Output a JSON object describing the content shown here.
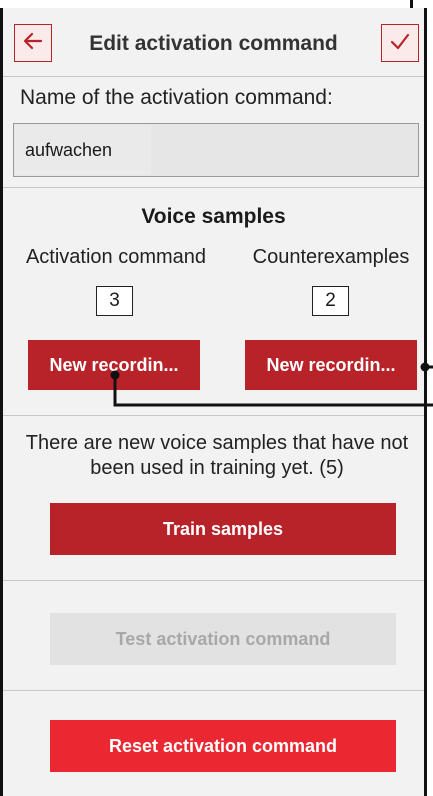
{
  "header": {
    "title": "Edit activation command",
    "back_icon": "arrow-left-icon",
    "confirm_icon": "checkmark-icon",
    "accent_color": "#b8232a"
  },
  "name_section": {
    "label": "Name of the activation command:",
    "value": "aufwachen"
  },
  "voice_samples": {
    "title": "Voice samples",
    "activation": {
      "label": "Activation command",
      "count": "3",
      "button": "New recordin..."
    },
    "counter": {
      "label": "Counterexamples",
      "count": "2",
      "button": "New recordin..."
    }
  },
  "training": {
    "info": "There are new voice samples that have not been used in training yet. (5)",
    "button": "Train samples"
  },
  "test": {
    "button": "Test activation command"
  },
  "reset": {
    "button": "Reset activation command",
    "color": "#eb2731"
  }
}
